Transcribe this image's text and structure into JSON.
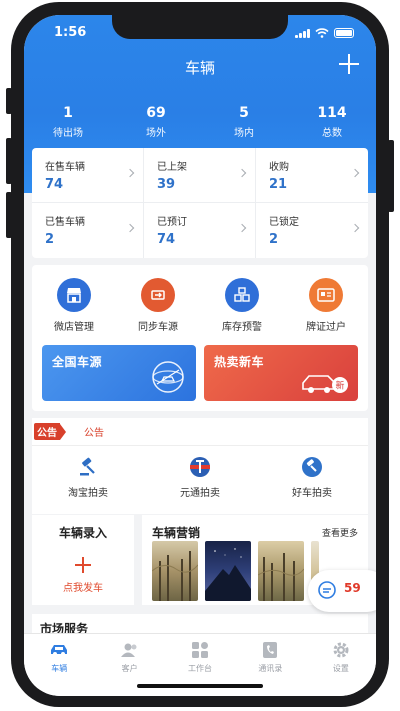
{
  "status": {
    "time": "1:56"
  },
  "nav": {
    "title": "车辆"
  },
  "stats": [
    {
      "value": "1",
      "label": "待出场"
    },
    {
      "value": "69",
      "label": "场外"
    },
    {
      "value": "5",
      "label": "场内"
    },
    {
      "value": "114",
      "label": "总数"
    }
  ],
  "inventory": [
    {
      "label": "在售车辆",
      "value": "74"
    },
    {
      "label": "已上架",
      "value": "39"
    },
    {
      "label": "收购",
      "value": "21"
    },
    {
      "label": "已售车辆",
      "value": "2"
    },
    {
      "label": "已预订",
      "value": "74"
    },
    {
      "label": "已锁定",
      "value": "2"
    }
  ],
  "menu": [
    {
      "label": "微店管理",
      "icon": "shop-icon",
      "color": "#2f6fd8"
    },
    {
      "label": "同步车源",
      "icon": "sync-icon",
      "color": "#e25a31"
    },
    {
      "label": "库存预警",
      "icon": "warehouse-icon",
      "color": "#2f6fd8"
    },
    {
      "label": "牌证过户",
      "icon": "license-icon",
      "color": "#ef7a35"
    }
  ],
  "banners": [
    {
      "label": "全国车源",
      "color": "#3a86ea"
    },
    {
      "label": "热卖新车",
      "color": "#e2534a"
    }
  ],
  "notice": {
    "badge": "公告",
    "text": "公告"
  },
  "auctions": [
    {
      "label": "淘宝拍卖",
      "icon": "gavel-icon"
    },
    {
      "label": "元通拍卖",
      "icon": "yuantong-logo-icon"
    },
    {
      "label": "好车拍卖",
      "icon": "hammer-icon"
    }
  ],
  "car_entry": {
    "title": "车辆录入",
    "subtitle": "点我发车"
  },
  "marketing": {
    "title": "车辆营销",
    "more": "查看更多"
  },
  "market_service": {
    "title": "市场服务"
  },
  "float_msg": {
    "count": "59"
  },
  "tabs": [
    {
      "label": "车辆",
      "icon": "car-icon",
      "active": true
    },
    {
      "label": "客户",
      "icon": "customers-icon"
    },
    {
      "label": "工作台",
      "icon": "workbench-icon"
    },
    {
      "label": "通讯录",
      "icon": "contacts-icon"
    },
    {
      "label": "设置",
      "icon": "settings-icon"
    }
  ],
  "colors": {
    "primary": "#2c86ea",
    "accent_red": "#e04a2d",
    "value_blue": "#2f72c9"
  }
}
